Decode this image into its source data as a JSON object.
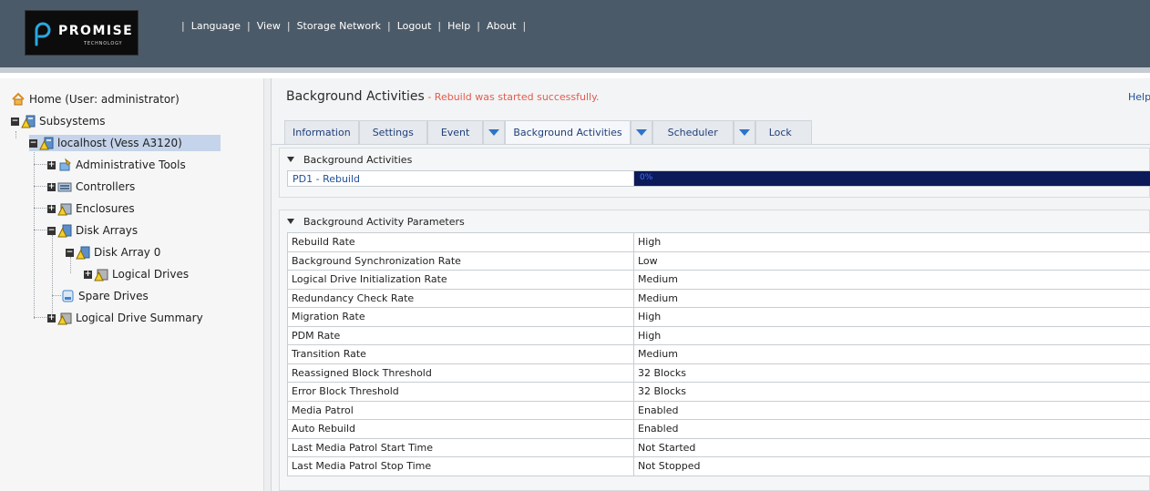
{
  "brand": {
    "name": "PROMISE",
    "sub": "TECHNOLOGY"
  },
  "topnav": [
    "Language",
    "View",
    "Storage Network",
    "Logout",
    "Help",
    "About"
  ],
  "tree": {
    "home": "Home (User: administrator)",
    "subsystems": "Subsystems",
    "localhost": "localhost (Vess A3120)",
    "admin_tools": "Administrative Tools",
    "controllers": "Controllers",
    "enclosures": "Enclosures",
    "disk_arrays": "Disk Arrays",
    "disk_array_0": "Disk Array 0",
    "logical_drives": "Logical Drives",
    "spare_drives": "Spare Drives",
    "logical_drive_summary": "Logical Drive Summary"
  },
  "page": {
    "title": "Background Activities",
    "status": " - Rebuild was started successfully.",
    "help": "Help"
  },
  "tabs": {
    "information": "Information",
    "settings": "Settings",
    "event": "Event",
    "background_activities": "Background Activities",
    "scheduler": "Scheduler",
    "lock": "Lock"
  },
  "bg_section": {
    "title": "Background Activities",
    "activity": "PD1 - Rebuild",
    "progress_label": "0%",
    "progress_fraction": 0.0
  },
  "params_section": {
    "title": "Background Activity Parameters",
    "rows": [
      [
        "Rebuild Rate",
        "High"
      ],
      [
        "Background Synchronization Rate",
        "Low"
      ],
      [
        "Logical Drive Initialization Rate",
        "Medium"
      ],
      [
        "Redundancy Check Rate",
        "Medium"
      ],
      [
        "Migration Rate",
        "High"
      ],
      [
        "PDM Rate",
        "High"
      ],
      [
        "Transition Rate",
        "Medium"
      ],
      [
        "Reassigned Block Threshold",
        "32 Blocks"
      ],
      [
        "Error Block Threshold",
        "32 Blocks"
      ],
      [
        "Media Patrol",
        "Enabled"
      ],
      [
        "Auto Rebuild",
        "Enabled"
      ],
      [
        "Last Media Patrol Start Time",
        "Not Started"
      ],
      [
        "Last Media Patrol Stop Time",
        "Not Stopped"
      ]
    ]
  },
  "colors": {
    "topbar": "#4b5a68",
    "status_red": "#e35b4e",
    "link_blue": "#1f4f99",
    "progress_track": "#0c1a5a",
    "selected_row": "#c5d4ea"
  }
}
